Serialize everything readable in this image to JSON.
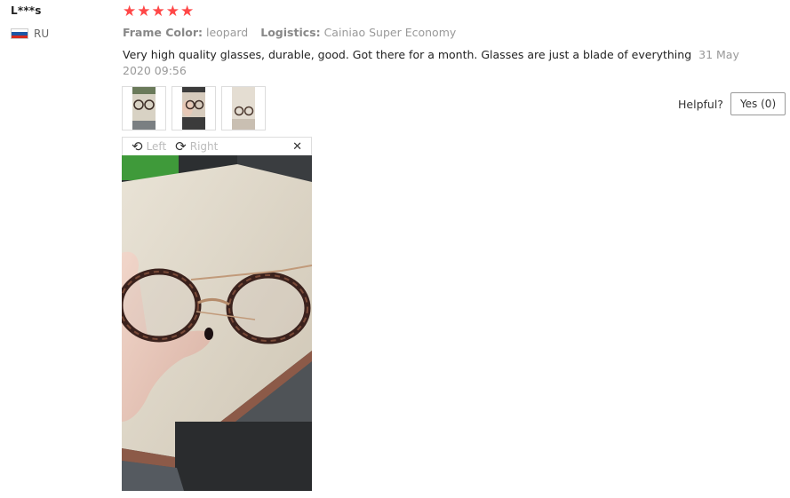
{
  "reviewer": {
    "name": "L***s",
    "country": "RU",
    "flag_colors": [
      "#ffffff",
      "#1c57a5",
      "#d52b1e"
    ]
  },
  "rating": {
    "stars": 5,
    "max": 5,
    "color": "#ff4747"
  },
  "attributes": {
    "frame_color_label": "Frame Color:",
    "frame_color_value": "leopard",
    "logistics_label": "Logistics:",
    "logistics_value": "Cainiao Super Economy"
  },
  "review": {
    "text": "Very high quality glasses, durable, good. Got there for a month. Glasses are just a blade of everything",
    "date": "31 May 2020 09:56"
  },
  "thumbnails": [
    {
      "icon": "photo-glasses-1"
    },
    {
      "icon": "photo-glasses-2"
    },
    {
      "icon": "photo-glasses-3"
    }
  ],
  "helpful": {
    "label": "Helpful?",
    "yes_label": "Yes (0)"
  },
  "viewer": {
    "rotate_left_label": "Left",
    "rotate_right_label": "Right",
    "rotate_left_icon": "rotate-left-icon",
    "rotate_right_icon": "rotate-right-icon",
    "close_icon": "close-icon"
  }
}
